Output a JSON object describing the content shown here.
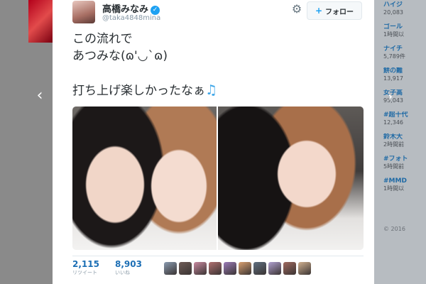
{
  "tweet": {
    "display_name": "高橋みなみ",
    "handle": "@taka4848mina",
    "follow_label": "フォロー",
    "text_line1": "この流れで",
    "text_line2": "あつみな(ɷ'◡`ɷ)",
    "text_line3": "打ち上げ楽しかったなぁ",
    "retweets": "2,115",
    "retweets_label": "リツイート",
    "likes": "8,903",
    "likes_label": "いいね",
    "liker_colors": [
      "#8a9bb0",
      "#6f5c57",
      "#c98aa0",
      "#b07070",
      "#9b7bb8",
      "#d9a070",
      "#5f6f80",
      "#b0a0d0",
      "#a06a60",
      "#d0b090"
    ]
  },
  "trends": [
    {
      "title": "ハイジ",
      "count": "20,083"
    },
    {
      "title": "ゴール",
      "count": "1時間以"
    },
    {
      "title": "ナイチ",
      "count": "5,789件"
    },
    {
      "title": "餅の難",
      "count": "13,917"
    },
    {
      "title": "女子高",
      "count": "95,043"
    },
    {
      "title": "#超十代",
      "count": "12,346"
    },
    {
      "title": "鈴木大",
      "count": "2時間前"
    },
    {
      "title": "#フォト",
      "count": "5時間前"
    },
    {
      "title": "#MMD",
      "count": "1時間以"
    }
  ],
  "footer": {
    "copyright": "© 2016"
  },
  "colors": {
    "link_blue": "#1da1f2",
    "count_blue": "#1d6fb5"
  }
}
